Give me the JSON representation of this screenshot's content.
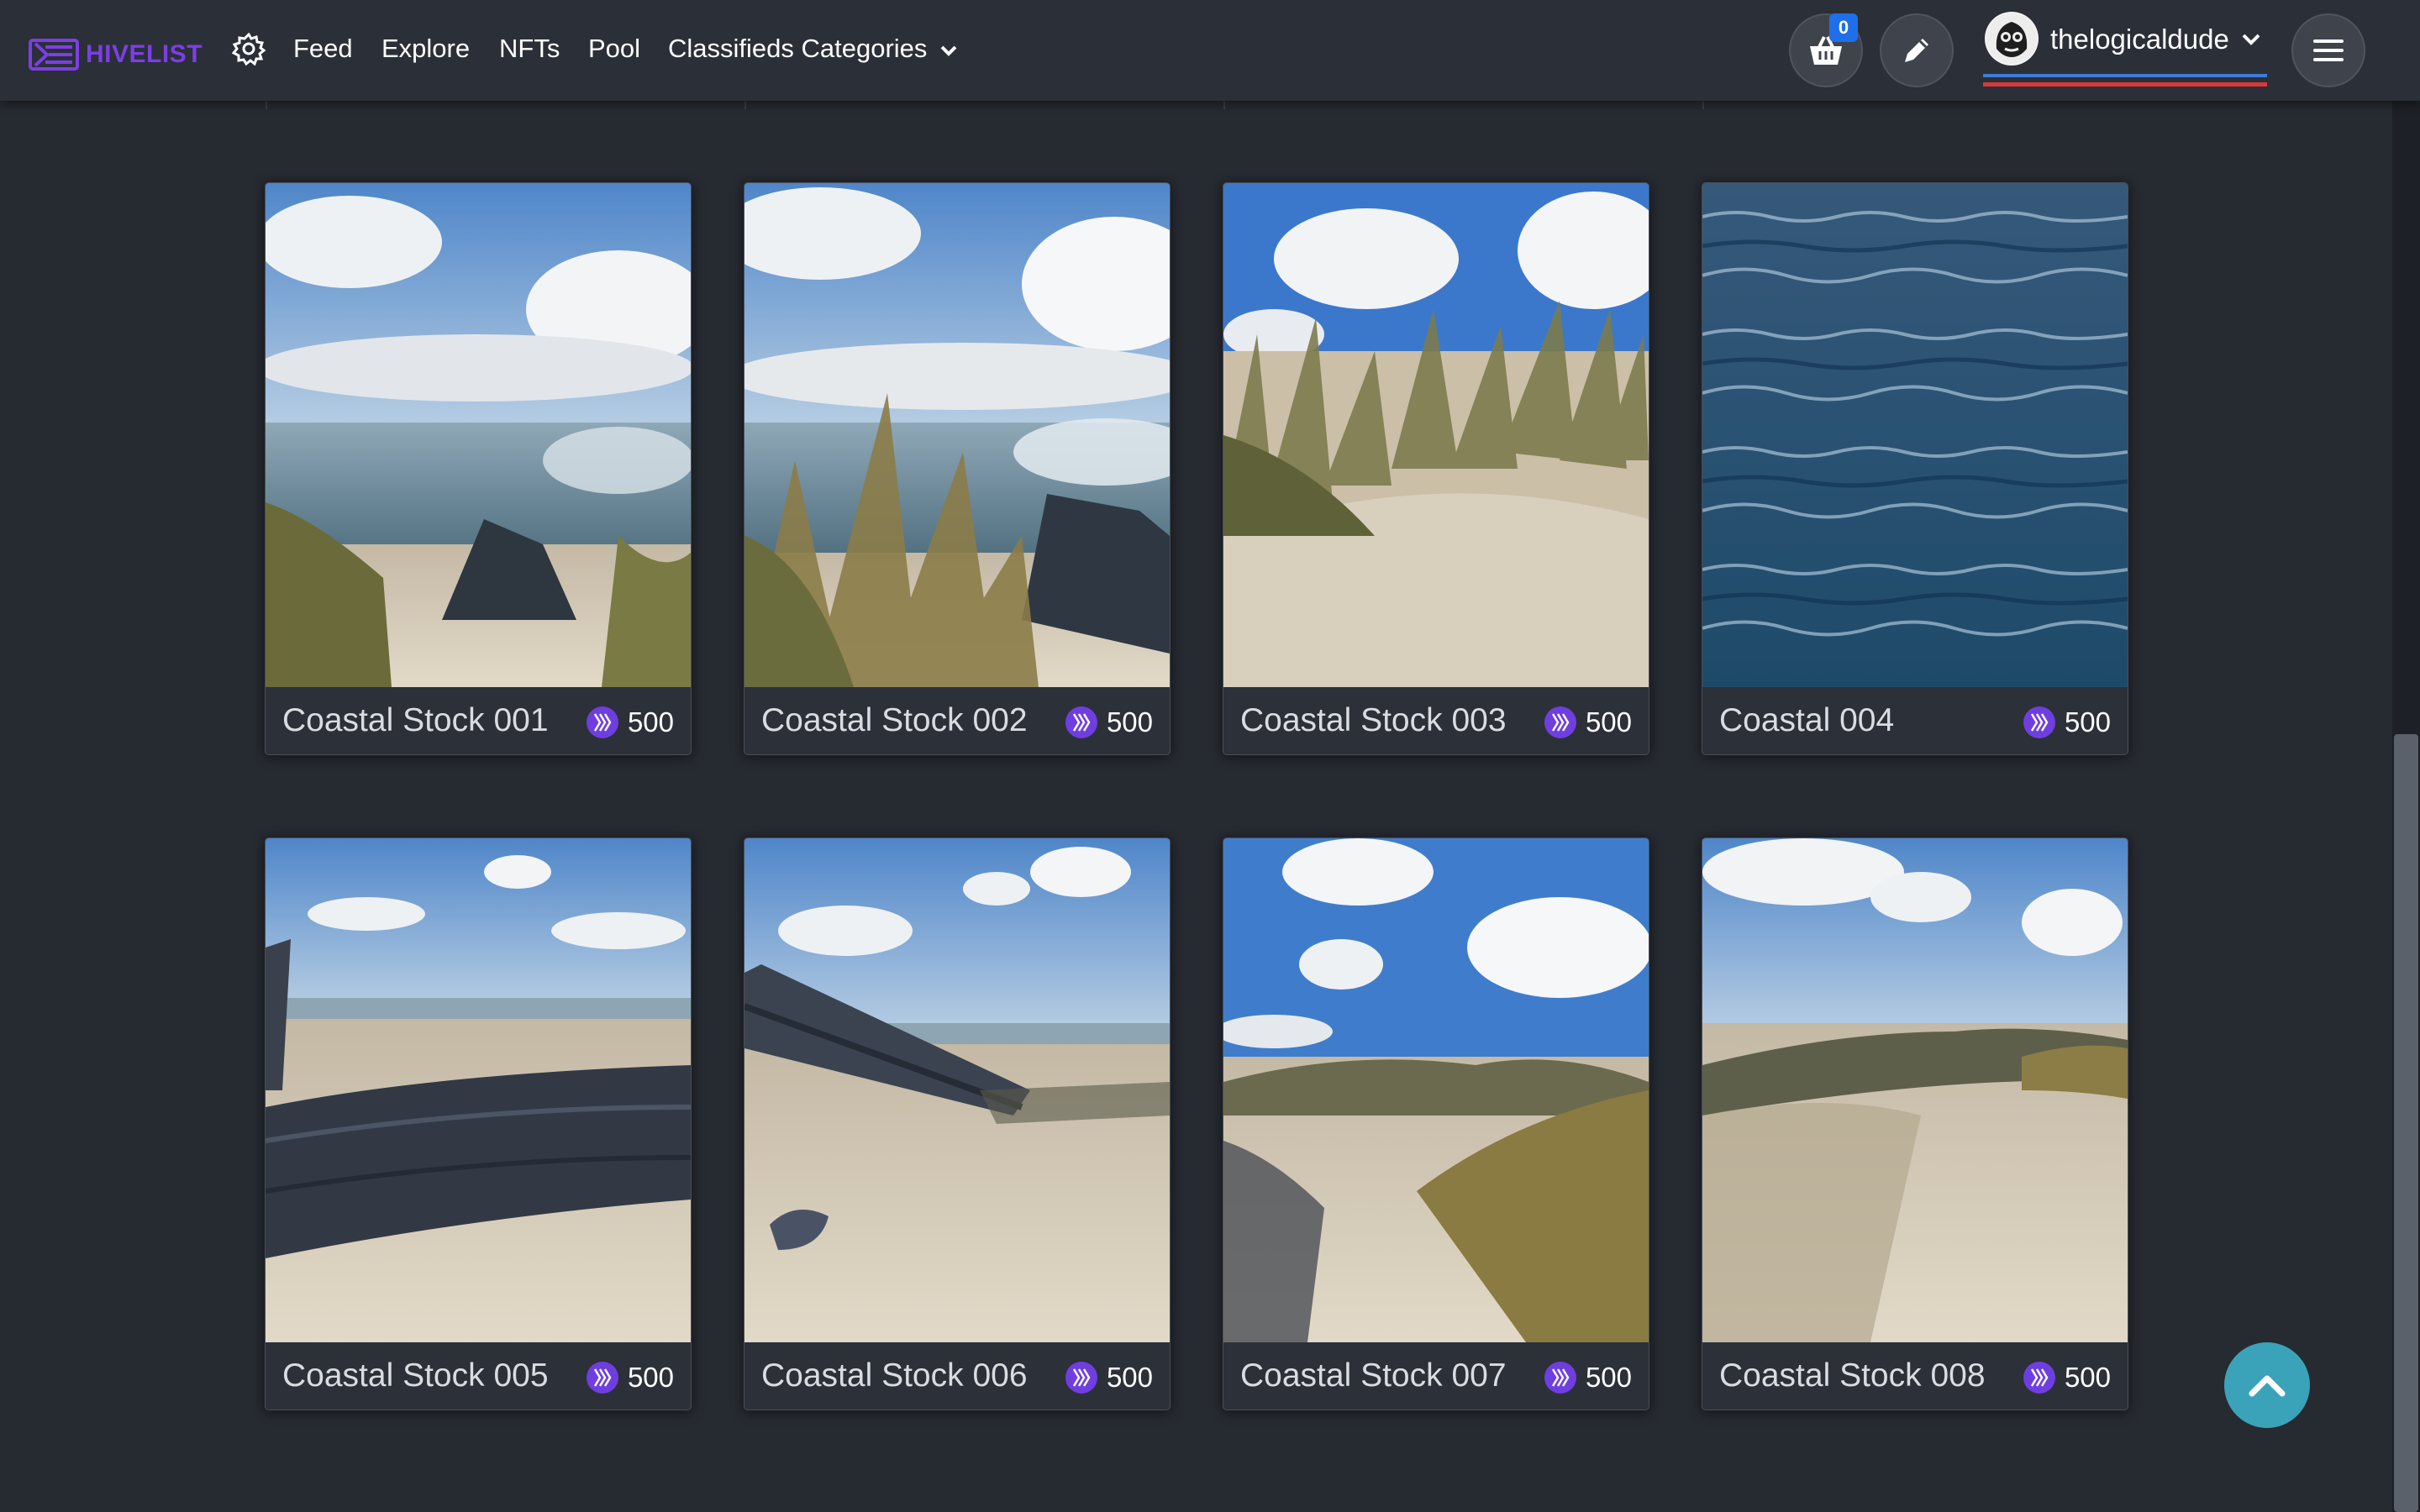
{
  "brand": {
    "name": "HIVELIST",
    "color": "#7b3fe4"
  },
  "nav": {
    "settings_icon": "gear-icon",
    "links": [
      "Feed",
      "Explore",
      "NFTs",
      "Pool"
    ],
    "categories_label": "Classifieds Categories"
  },
  "cart": {
    "count": "0",
    "icon": "basket-icon"
  },
  "compose": {
    "icon": "pencil-icon"
  },
  "user": {
    "username": "thelogicaldude",
    "icon": "chevron-down-icon"
  },
  "menu": {
    "icon": "hamburger-icon"
  },
  "listings": [
    {
      "title": "Coastal Stock 001",
      "price": "500",
      "scene": "dune-rock"
    },
    {
      "title": "Coastal Stock 002",
      "price": "500",
      "scene": "grass-rock"
    },
    {
      "title": "Coastal Stock 003",
      "price": "500",
      "scene": "grass-dune"
    },
    {
      "title": "Coastal 004",
      "price": "500",
      "scene": "water"
    },
    {
      "title": "Coastal Stock 005",
      "price": "500",
      "scene": "driftwood"
    },
    {
      "title": "Coastal Stock 006",
      "price": "500",
      "scene": "driftwood-sand"
    },
    {
      "title": "Coastal Stock 007",
      "price": "500",
      "scene": "dune-path"
    },
    {
      "title": "Coastal Stock 008",
      "price": "500",
      "scene": "sand-path"
    }
  ],
  "price_currency_icon": "hive-coin-icon",
  "back_to_top": {
    "icon": "chevron-up-icon",
    "color": "#3ba3b9"
  }
}
